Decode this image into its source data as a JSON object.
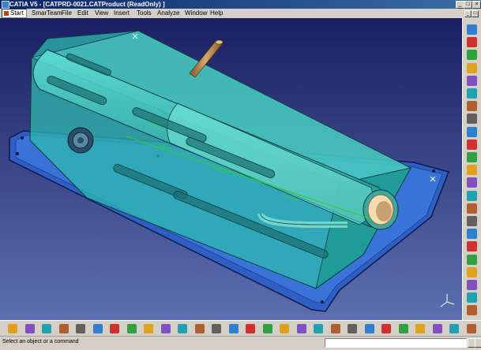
{
  "window": {
    "title": "CATIA V5 - [CATPRD-0021.CATProduct (ReadOnly) ]"
  },
  "menu": {
    "items": [
      "Start",
      "SmarTeam",
      "File",
      "Edit",
      "View",
      "Insert",
      "Tools",
      "Analyze",
      "Window",
      "Help"
    ]
  },
  "colors": {
    "background_top": "#1a1f63",
    "background_bottom": "#5d6fb0",
    "part_fill": "#2fb8b0",
    "base_plate": "#2f5fc4",
    "tube_brown": "#b8874a"
  },
  "right_toolbar": {
    "icons": [
      "product-structure-icon",
      "select-icon",
      "plane-icon",
      "component-icon",
      "new-component-icon",
      "existing-component-icon",
      "replace-icon",
      "graph-tree-icon",
      "generate-numbering-icon",
      "selective-load-icon",
      "manage-representations-icon",
      "multi-instantiation-icon",
      "fast-multi-instantiation-icon",
      "reorder-tree-icon",
      "move-icon",
      "snap-icon",
      "constraint-icon",
      "fix-icon",
      "coincidence-icon",
      "contact-icon",
      "offset-icon",
      "angle-icon",
      "catia-logo-icon"
    ]
  },
  "bottom_toolbar": {
    "icons": [
      "sketcher-icon",
      "fit-all-icon",
      "pan-icon",
      "rotate-icon",
      "zoom-in-icon",
      "zoom-out-icon",
      "normal-view-icon",
      "iso-view-icon",
      "shading-icon",
      "hide-show-icon",
      "swap-visible-icon",
      "measure-icon",
      "catalog-icon",
      "bom-icon",
      "update-icon",
      "scenes-icon",
      "snapshot-icon",
      "space-analysis-icon",
      "clash-icon",
      "sectioning-icon",
      "distance-icon",
      "annotation-icon",
      "hyperlink-icon",
      "weld-icon",
      "tree-icon",
      "publication-icon",
      "compass-icon",
      "help-icon"
    ]
  },
  "status": {
    "message": "Select an object or a command",
    "command_input": ""
  }
}
